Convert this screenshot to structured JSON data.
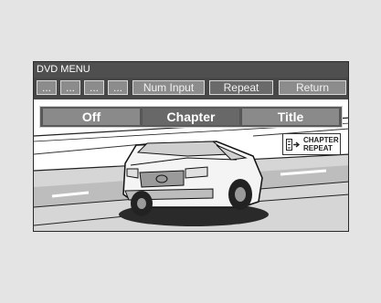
{
  "window": {
    "title": "DVD MENU"
  },
  "toolbar": {
    "dots": [
      "...",
      "...",
      "...",
      "..."
    ],
    "num_input": "Num Input",
    "repeat": "Repeat",
    "return": "Return"
  },
  "repeat_modes": {
    "off": "Off",
    "chapter": "Chapter",
    "title": "Title",
    "selected": "Chapter"
  },
  "status": {
    "line1": "CHAPTER",
    "line2": "REPEAT",
    "icon": "repeat-icon"
  },
  "colors": {
    "title_bar": "#4f4f4f",
    "button": "#8c8c8c",
    "button_selected": "#686868",
    "background": "#e4e4e4"
  }
}
